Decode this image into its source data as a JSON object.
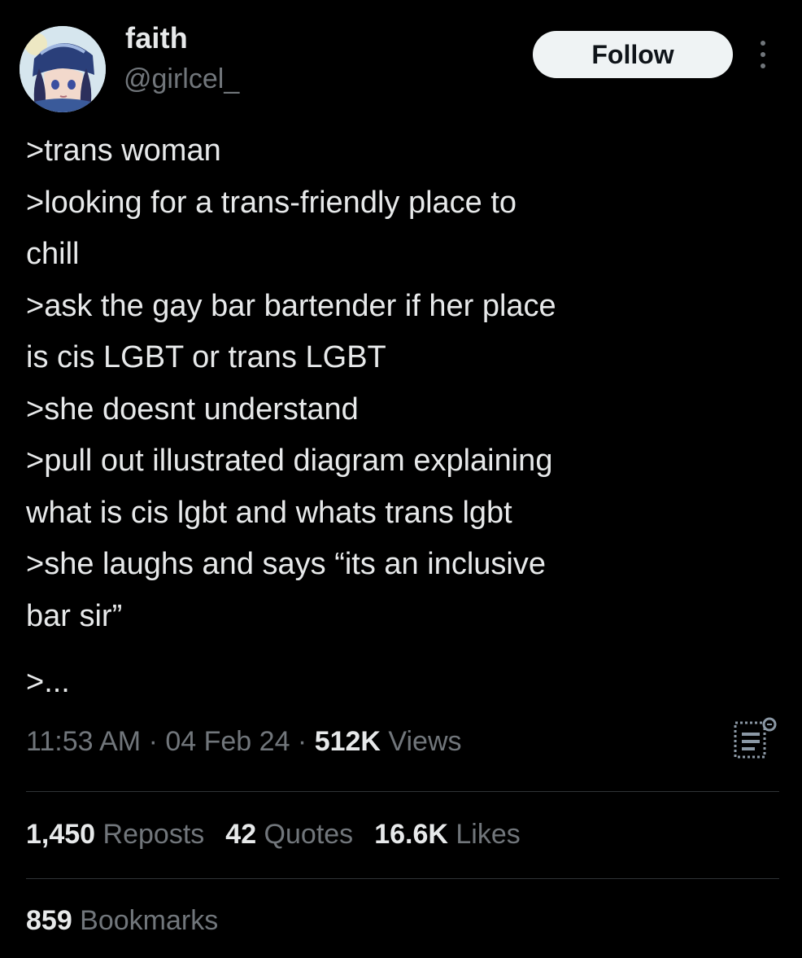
{
  "author": {
    "display_name": "faith",
    "handle": "@girlcel_",
    "avatar_icon": "anime-avatar"
  },
  "follow_button": {
    "label": "Follow"
  },
  "more_icon": "more-dots-icon",
  "tweet": {
    "lines": [
      ">trans woman",
      ">looking for a trans-friendly place to",
      "chill",
      ">ask the gay bar bartender if her place",
      "is cis LGBT or trans LGBT",
      ">she doesnt understand",
      ">pull out illustrated diagram explaining",
      "what is cis lgbt and whats trans lgbt",
      ">she laughs and says “its an inclusive",
      "bar sir”",
      ">..."
    ]
  },
  "meta": {
    "time": "11:53 AM",
    "separator": " · ",
    "date": "04 Feb 24",
    "views_count": "512K",
    "views_label": " Views"
  },
  "analytics_icon": "analytics-icon",
  "stats": {
    "reposts_count": "1,450",
    "reposts_label": " Reposts",
    "quotes_count": "42",
    "quotes_label": " Quotes",
    "likes_count": "16.6K",
    "likes_label": " Likes",
    "bookmarks_count": "859",
    "bookmarks_label": " Bookmarks"
  },
  "colors": {
    "background": "#000000",
    "primary_text": "#e7e9ea",
    "secondary_text": "#71767b",
    "divider": "#2f3336",
    "follow_bg": "#eff3f4"
  }
}
